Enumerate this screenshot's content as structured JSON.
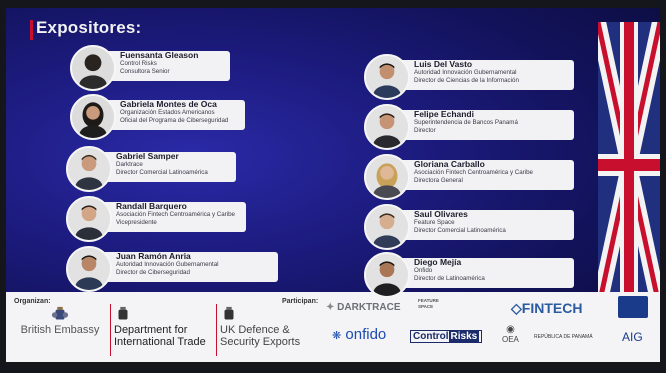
{
  "title": "Expositores:",
  "speakers_left": [
    {
      "name": "Fuensanta Gleason",
      "org": "Control Risks",
      "role": "Consultora Senior",
      "role2": ""
    },
    {
      "name": "Gabriela Montes de Oca",
      "org": "Organización Estados Americanos",
      "role": "Oficial del Programa de Ciberseguridad",
      "role2": ""
    },
    {
      "name": "Gabriel Samper",
      "org": "Darktrace",
      "role": "Director Comercial Latinoamérica",
      "role2": ""
    },
    {
      "name": "Randall Barquero",
      "org": "Asociación Fintech Centroamérica y Caribe",
      "role": "Vicepresidente",
      "role2": ""
    },
    {
      "name": "Juan Ramón Anria",
      "org": "Autoridad Innovación Gubernamental",
      "role": "Director de Ciberseguridad",
      "role2": ""
    }
  ],
  "speakers_right": [
    {
      "name": "Luis Del Vasto",
      "org": "Autoridad Innovación Gubernamental",
      "role": "Director de Ciencias de la Información",
      "role2": ""
    },
    {
      "name": "Felipe Echandi",
      "org": "Superintendencia de Bancos Panamá",
      "role": "Director",
      "role2": ""
    },
    {
      "name": "Gloriana Carballo",
      "org": "Asociación Fintech Centroamérica y Caribe",
      "role": "Directora General",
      "role2": ""
    },
    {
      "name": "Saul Olivares",
      "org": "Feature Space",
      "role": "Director Comercial Latinoamérica",
      "role2": ""
    },
    {
      "name": "Diego Mejía",
      "org": "Onfido",
      "role": "Director de Latinoamérica",
      "role2": ""
    }
  ],
  "footer": {
    "organizan": "Organizan:",
    "participan": "Participan:",
    "british_embassy": "British Embassy",
    "dit_1": "Department for",
    "dit_2": "International Trade",
    "ukdse_1": "UK Defence &",
    "ukdse_2": "Security Exports",
    "darktrace": "DARKTRACE",
    "feature_space": "FEATURE SPACE",
    "fintech": "FINTECH",
    "onfido": "onfido",
    "control": "Control",
    "risks": "Risks",
    "oea": "OEA",
    "panama": "REPÚBLICA DE PANAMÁ",
    "aig": "AIG"
  },
  "colors": {
    "accent": "#c8102e",
    "background": "#1c1b7e",
    "card": "#f2f2f4"
  }
}
